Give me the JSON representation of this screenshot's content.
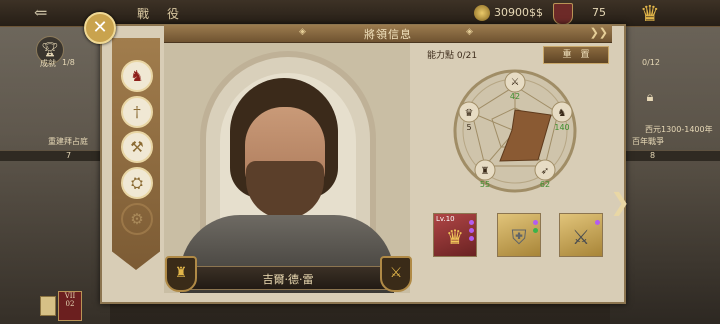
{
  "topbar": {
    "title": "戰　役",
    "currency": "30900$$",
    "counter": "75"
  },
  "background": {
    "left_label_1": "成就",
    "left_fraction": "1/8",
    "left_caption": "重建拜占庭",
    "left_badge": "7",
    "right_fraction": "0/12",
    "right_years": "西元1300-1400年",
    "right_caption": "百年戰爭",
    "right_badge": "8",
    "bottom_roman_1": "VII",
    "bottom_roman_2": "02"
  },
  "modal": {
    "header_title": "將領信息",
    "ability_points": "能力點 0/21",
    "reset_label": "重　置",
    "general_name": "吉爾·德·雷"
  },
  "stats": [
    {
      "name": "attack",
      "icon": "crossed-swords-icon",
      "value": "42"
    },
    {
      "name": "cavalry",
      "icon": "horse-icon",
      "value": "140"
    },
    {
      "name": "archery",
      "icon": "bow-icon",
      "value": "62"
    },
    {
      "name": "defense",
      "icon": "fortress-icon",
      "value": "55"
    },
    {
      "name": "command",
      "icon": "crown-icon",
      "value": "5"
    }
  ],
  "equipment": [
    {
      "name": "crown",
      "level": "Lv.10"
    },
    {
      "name": "armor"
    },
    {
      "name": "sword"
    }
  ],
  "colors": {
    "stat_green": "#3f8f2e",
    "stat_dark": "#3a2a18",
    "radar_fill": "#8a5a33"
  }
}
